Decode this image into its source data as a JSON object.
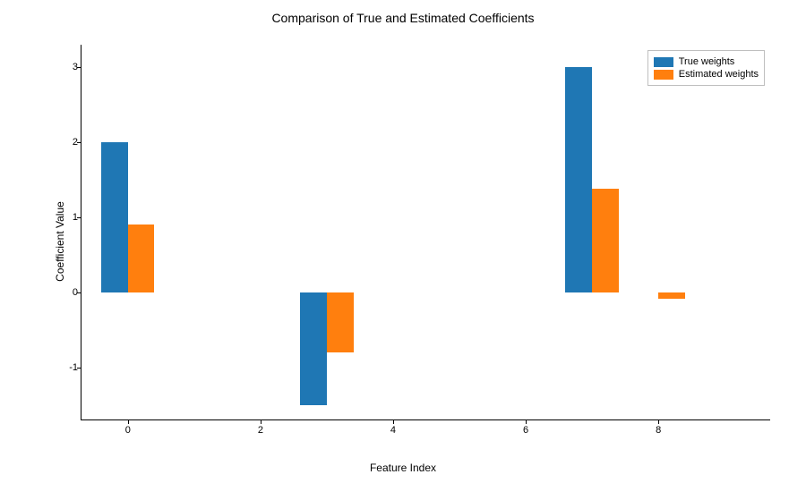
{
  "chart_data": {
    "type": "bar",
    "title": "Comparison of True and Estimated Coefficients",
    "xlabel": "Feature Index",
    "ylabel": "Coefficient Value",
    "x": [
      0,
      1,
      2,
      3,
      4,
      5,
      6,
      7,
      8,
      9
    ],
    "x_ticks": [
      0,
      2,
      4,
      6,
      8
    ],
    "y_ticks": [
      -1,
      0,
      1,
      2,
      3
    ],
    "ylim": [
      -1.7,
      3.3
    ],
    "series": [
      {
        "name": "True weights",
        "color": "#1f77b4",
        "values": [
          2.0,
          0,
          0,
          -1.5,
          0,
          0,
          0,
          3.0,
          0,
          0
        ]
      },
      {
        "name": "Estimated weights",
        "color": "#ff7f0e",
        "values": [
          0.91,
          0,
          0,
          -0.8,
          0,
          0,
          0,
          1.38,
          -0.08,
          0
        ]
      }
    ],
    "legend_position": "upper right",
    "bar_width": 0.4
  }
}
